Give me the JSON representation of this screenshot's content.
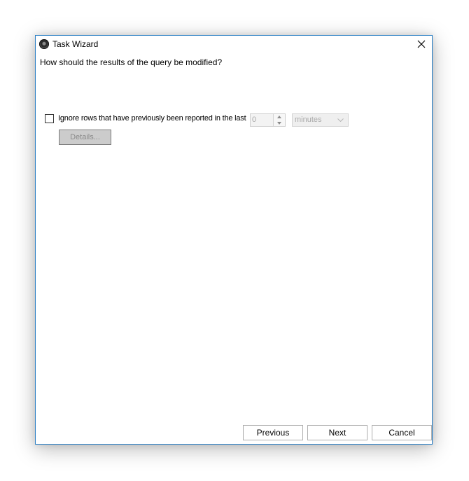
{
  "window": {
    "title": "Task Wizard",
    "icon": "app-icon"
  },
  "question": "How should the results of the query be modified?",
  "ignore_rows": {
    "checked": false,
    "label": "Ignore rows that have previously been reported in the last",
    "amount": "0",
    "unit": "minutes",
    "details_label": "Details..."
  },
  "footer": {
    "previous_label": "Previous",
    "next_label": "Next",
    "cancel_label": "Cancel"
  },
  "colors": {
    "window_border": "#2b7fc4",
    "disabled_text": "#a9a9a9"
  }
}
